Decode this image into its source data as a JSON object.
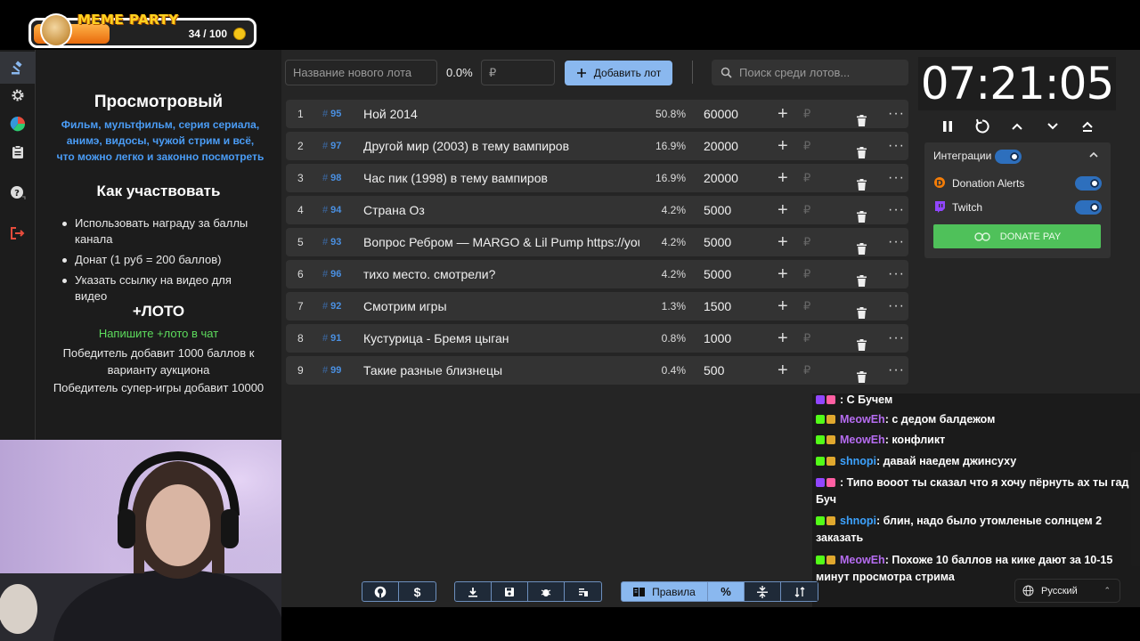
{
  "overlay": {
    "meme_title": "MEME PARTY",
    "meme_count": "34 / 100",
    "meme_progress": 0.34
  },
  "info": {
    "title": "Просмотровый",
    "desc_lines": [
      "Фильм, мультфильм, серия сериала,",
      "анимэ, видосы, чужой стрим и всё,",
      "что можно легко и законно посмотреть"
    ],
    "how_title": "Как участвовать",
    "bullets": [
      "Использовать награду за баллы канала",
      "Донат (1 руб = 200 баллов)",
      "Указать ссылку на видео для видео"
    ],
    "loto_title": "+ЛОТО",
    "loto_hint": "Напишите +лото в чат",
    "loto_text1": "Победитель добавит 1000 баллов к варианту аукциона",
    "loto_text2": "Победитель супер-игры добавит 10000"
  },
  "toolbar": {
    "new_lot_placeholder": "Название нового лота",
    "percent": "0.0%",
    "currency": "₽",
    "add_label": "Добавить лот",
    "search_placeholder": "Поиск среди лотов..."
  },
  "lots": [
    {
      "num": "1",
      "id": "95",
      "name": "Ной 2014",
      "pct": "50.8%",
      "amount": "60000"
    },
    {
      "num": "2",
      "id": "97",
      "name": "Другой мир (2003) в тему вампиров",
      "pct": "16.9%",
      "amount": "20000"
    },
    {
      "num": "3",
      "id": "98",
      "name": "Час пик (1998) в тему вампиров",
      "pct": "16.9%",
      "amount": "20000"
    },
    {
      "num": "4",
      "id": "94",
      "name": "Страна Оз",
      "pct": "4.2%",
      "amount": "5000"
    },
    {
      "num": "5",
      "id": "93",
      "name": "Вопрос Ребром — MARGO & Lil Pump https://you",
      "pct": "4.2%",
      "amount": "5000"
    },
    {
      "num": "6",
      "id": "96",
      "name": "тихо место. смотрели?",
      "pct": "4.2%",
      "amount": "5000"
    },
    {
      "num": "7",
      "id": "92",
      "name": "Смотрим игры",
      "pct": "1.3%",
      "amount": "1500"
    },
    {
      "num": "8",
      "id": "91",
      "name": "Кустурица - Бремя цыган",
      "pct": "0.8%",
      "amount": "1000"
    },
    {
      "num": "9",
      "id": "99",
      "name": "Такие разные близнецы",
      "pct": "0.4%",
      "amount": "500"
    }
  ],
  "row_icons": {
    "plus": "+",
    "rub": "₽",
    "more": "···",
    "hash": "#"
  },
  "timer": {
    "value": "07:21:05"
  },
  "integrations": {
    "title": "Интеграции",
    "items": [
      "Donation Alerts",
      "Twitch"
    ],
    "donate_label": "DONATE PAY"
  },
  "chat": [
    {
      "user": "",
      "text": ": С Бучем",
      "color": "#4b2bd6",
      "platform": "twitch"
    },
    {
      "user": "MeowEh",
      "text": ": с дедом балдежом",
      "color": "#b56cf0",
      "platform": "kick"
    },
    {
      "user": "MeowEh",
      "text": ": конфликт",
      "color": "#b56cf0",
      "platform": "kick"
    },
    {
      "user": "shnopi",
      "text": ": давай наедем джинсуху",
      "color": "#3da3ff",
      "platform": "kick"
    },
    {
      "user": "",
      "text": ": Типо вооот ты сказал что я хочу пёрнуть ах ты гад Буч",
      "color": "#4b2bd6",
      "platform": "twitch"
    },
    {
      "user": "shnopi",
      "text": ": блин, надо было утомленые солнцем 2 заказать",
      "color": "#3da3ff",
      "platform": "kick"
    },
    {
      "user": "MeowEh",
      "text": ": Похоже 10 баллов на кике дают за 10-15 минут просмотра стрима",
      "color": "#b56cf0",
      "platform": "kick"
    }
  ],
  "bottom": {
    "rules_label": "Правила"
  },
  "language": {
    "selected": "Русский"
  },
  "colors": {
    "accent": "#8ab8ef",
    "green": "#4fc15a",
    "background": "#252525"
  }
}
